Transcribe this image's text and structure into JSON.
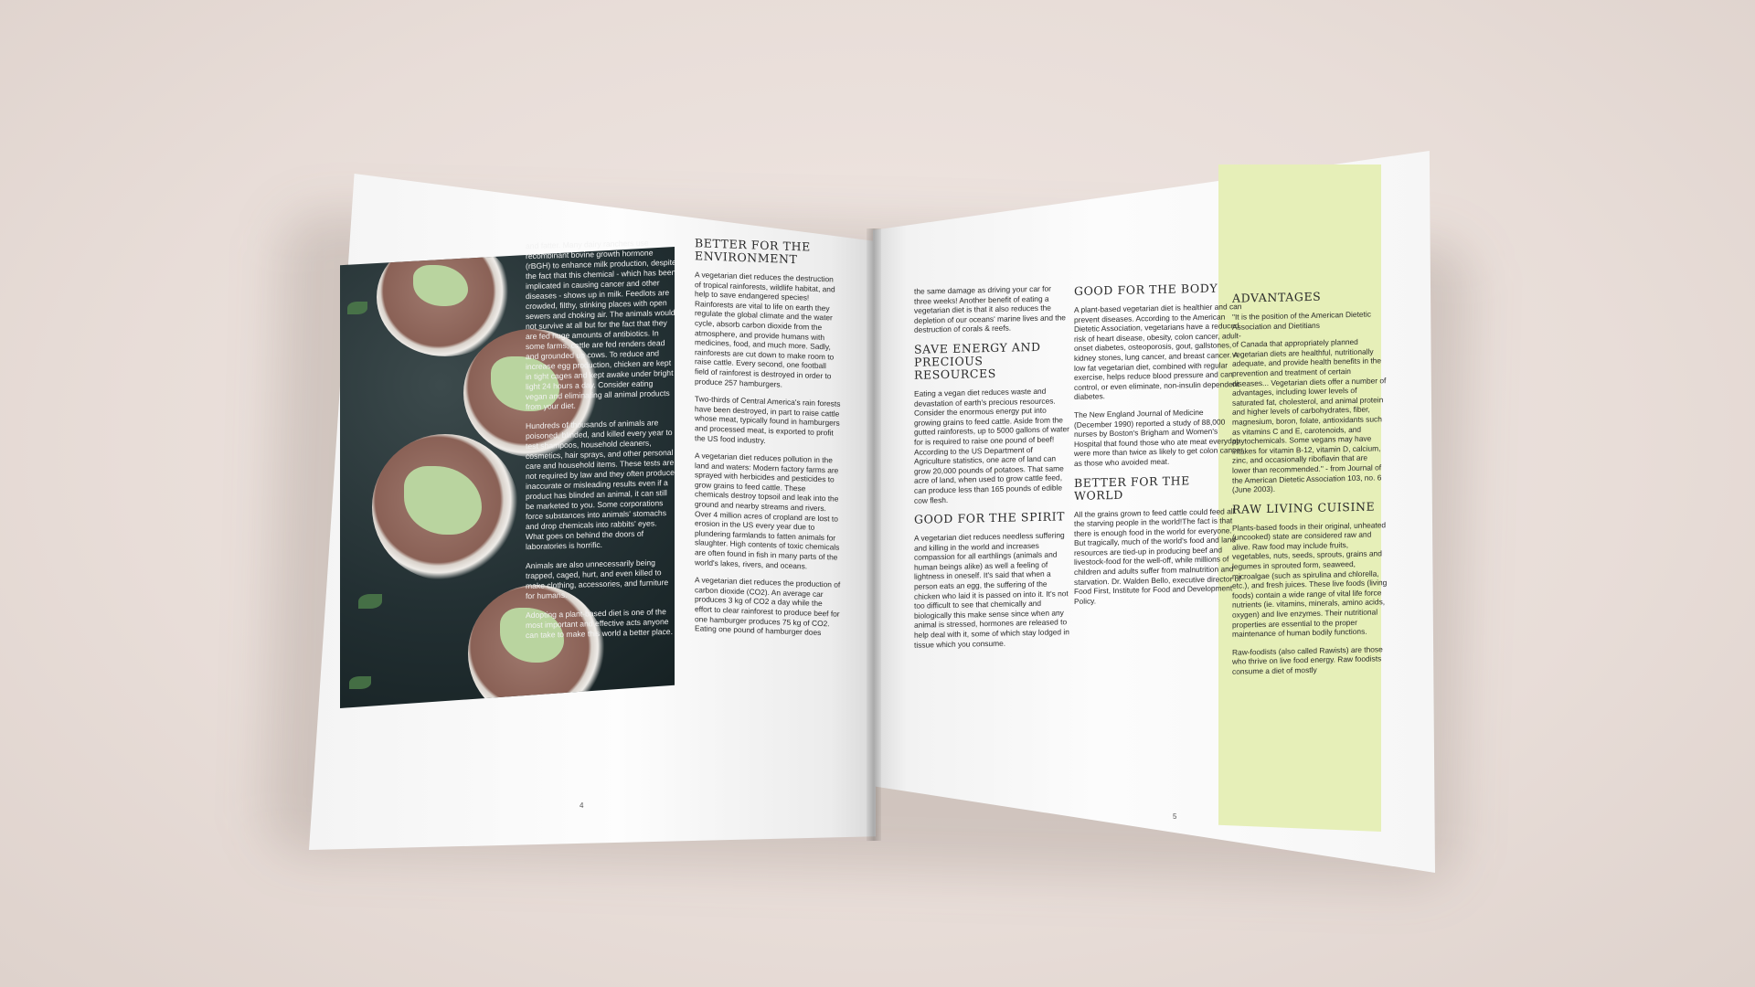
{
  "left_page": {
    "photo_overlay": [
      "and fatter. Many dairy ranchers use recombinant bovine growth hormone (rBGH) to enhance milk production, despite the fact that this chemical - which has been implicated in causing cancer and other diseases - shows up in milk. Feedlots are crowded, filthy, stinking places with open sewers and choking air. The animals would not survive at all but for the fact that they are fed huge amounts of antibiotics. In some farms, cattle are fed renders dead and grounded up cows. To reduce and increase egg production, chicken are kept in tight cages and kept awake under bright light 24 hours a day. Consider eating vegan and eliminating all animal products from your diet.",
      "Hundreds of thousands of animals are poisoned, blinded, and killed every year to test shampoos, household cleaners, cosmetics, hair sprays, and other personal care and household items. These tests are not required by law and they often produce inaccurate or misleading results even if a product has blinded an animal, it can still be marketed to you. Some corporations force substances into animals' stomachs and drop chemicals into rabbits' eyes. What goes on behind the doors of laboratories is horrific.",
      "Animals are also unnecessarily being trapped, caged, hurt, and even killed to make clothing, accessories, and furniture for humans.",
      "Adopting a plant-based diet is one of the most important and effective acts anyone can take to make this world a better place."
    ],
    "heading": "BETTER FOR THE ENVIRONMENT",
    "paragraphs": [
      "A vegetarian diet reduces the destruction of tropical rainforests, wildlife habitat, and help to save endangered species! Rainforests are vital to life on earth they regulate the global climate and the water cycle, absorb carbon dioxide from the atmosphere, and provide humans with medicines, food, and much more. Sadly, rainforests are cut down to make room to raise cattle. Every second, one football field of rainforest is destroyed in order to produce 257 hamburgers.",
      "Two-thirds of Central America's rain forests have been destroyed, in part to raise cattle whose meat, typically found in hamburgers and processed meat, is exported to profit the US food industry.",
      "A vegetarian diet reduces pollution in the land and waters: Modern factory farms are sprayed with herbicides and pesticides to grow grains to feed cattle. These chemicals destroy topsoil and leak into the ground and nearby streams and rivers. Over 4 million acres of cropland are lost to erosion in the US every year due to plundering farmlands to fatten animals for slaughter. High contents of toxic chemicals are often found in fish in many parts of the world's lakes, rivers, and oceans.",
      "A vegetarian diet reduces the production of carbon dioxide (CO2). An average car produces 3 kg of CO2 a day while the effort to clear rainforest to produce beef for one hamburger produces 75 kg of CO2. Eating one pound of hamburger does"
    ],
    "page_number": "4"
  },
  "right_page": {
    "col1": {
      "intro": "the same damage as driving your car for three weeks! Another benefit of eating a vegetarian diet is that it also reduces the depletion of our oceans' marine lives and the destruction of corals & reefs.",
      "heading_a": "SAVE ENERGY AND PRECIOUS RESOURCES",
      "text_a": "Eating a vegan diet reduces waste and devastation of earth's precious resources. Consider the enormous energy put into growing grains to feed cattle. Aside from the gutted rainforests, up to 5000 gallons of water for is required to raise one pound of beef! According to the US Department of Agriculture statistics, one acre of land can grow 20,000 pounds of potatoes. That same acre of land, when used to grow cattle feed, can produce less than 165 pounds of edible cow flesh.",
      "heading_b": "GOOD FOR THE SPIRIT",
      "text_b": "A vegetarian diet reduces needless suffering and killing in the world and increases compassion for all earthlings (animals and human beings alike) as well a feeling of lightness in oneself. It's said that when a person eats an egg, the suffering of the chicken who laid it is passed on into it. It's not too difficult to see that chemically and biologically this make sense since when any animal is stressed, hormones are released to help deal with it, some of which stay lodged in tissue which you consume."
    },
    "col2": {
      "heading_a": "GOOD FOR THE BODY",
      "text_a": "A plant-based vegetarian diet is healthier and can prevent diseases. According to the American Dietetic Association, vegetarians have a reduced risk of heart disease, obesity, colon cancer, adult-onset diabetes, osteoporosis, gout, gallstones, kidney stones, lung cancer, and breast cancer. A low fat vegetarian diet, combined with regular exercise, helps reduce blood pressure and can control, or even eliminate, non-insulin dependent diabetes.",
      "text_a2": "The New England Journal of Medicine (December 1990) reported a study of 88,000 nurses by Boston's Brigham and Women's Hospital that found those who ate meat everyday were more than twice as likely to get colon cancer as those who avoided meat.",
      "heading_b": "BETTER FOR THE WORLD",
      "text_b": "All the grains grown to feed cattle could feed all the starving people in the world!The fact is that there is enough food in the world for everyone. But tragically, much of the world's food and land resources are tied-up in producing beef and livestock-food for the well-off, while millions of children and adults suffer from malnutrition and starvation. Dr. Walden Bello, executive director of Food First, Institute for Food and Development Policy."
    },
    "col3": {
      "heading_a": "ADVANTAGES",
      "quote_a": "\"It is the position of the American Dietetic Association and Dietitians",
      "text_a": "of Canada that appropriately planned vegetarian diets are healthful, nutritionally adequate, and provide health benefits in the prevention and treatment of certain diseases... Vegetarian diets offer a number of advantages, including lower levels of saturated fat, cholesterol, and animal protein and higher levels of carbohydrates, fiber, magnesium, boron, folate, antioxidants such as vitamins C and E, carotenoids, and phytochemicals. Some vegans may have intakes for vitamin B-12, vitamin D, calcium, zinc, and occasionally riboflavin that are lower than recommended.\" - from Journal of the American Dietetic Association 103, no. 6 (June 2003).",
      "heading_b": "RAW LIVING CUISINE",
      "text_b": "Plants-based foods in their original, unheated (uncooked) state are considered raw and alive. Raw food may include fruits, vegetables, nuts, seeds, sprouts, grains and legumes in sprouted form, seaweed, microalgae (such as spirulina and chlorella, etc.), and fresh juices. These live foods (living foods) contain a wide range of vital life force nutrients (ie. vitamins, minerals, amino acids, oxygen) and live enzymes. Their nutritional properties are essential to the proper maintenance of human bodily functions.",
      "text_b2": "Raw-foodists (also called Rawists) are those who thrive on live food energy. Raw foodists consume a diet of mostly"
    },
    "page_number": "5"
  },
  "colors": {
    "accent_panel": "#e6efb8",
    "photo_bg": "#233033",
    "text": "#2a2a2a"
  }
}
